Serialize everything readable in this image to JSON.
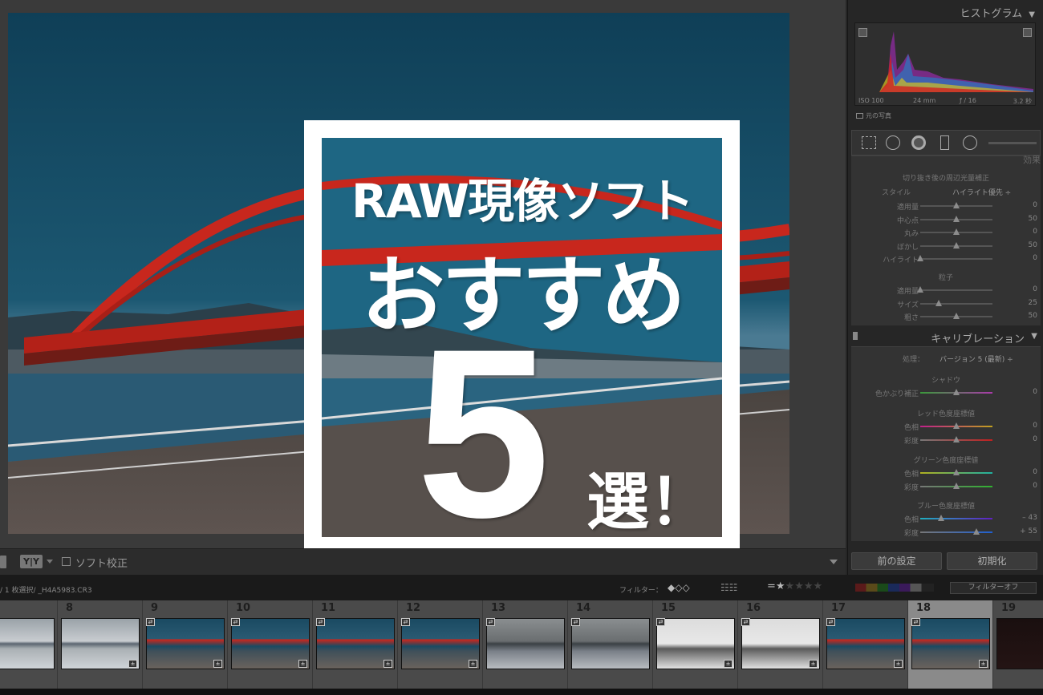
{
  "overlay": {
    "line1": "RAW現像ソフト",
    "line2": "おすすめ",
    "number": "5",
    "suffix": "選！"
  },
  "histogram": {
    "title": "ヒストグラム",
    "iso": "ISO 100",
    "focal": "24 mm",
    "aperture": "ƒ / 16",
    "shutter": "3.2 秒",
    "original_label": "元の写真"
  },
  "effects": {
    "title": "効果",
    "vignette_title": "切り抜き後の周辺光量補正",
    "style_label": "スタイル",
    "style_value": "ハイライト優先 ÷",
    "vignette_rows": [
      {
        "label": "適用量",
        "value": "0",
        "pos": 0.5
      },
      {
        "label": "中心点",
        "value": "50",
        "pos": 0.5
      },
      {
        "label": "丸み",
        "value": "0",
        "pos": 0.5
      },
      {
        "label": "ぼかし",
        "value": "50",
        "pos": 0.5
      },
      {
        "label": "ハイライト",
        "value": "0",
        "pos": 0.0
      }
    ],
    "grain_title": "粒子",
    "grain_rows": [
      {
        "label": "適用量",
        "value": "0",
        "pos": 0.0
      },
      {
        "label": "サイズ",
        "value": "25",
        "pos": 0.25
      },
      {
        "label": "粗さ",
        "value": "50",
        "pos": 0.5
      }
    ]
  },
  "calibration": {
    "title": "キャリブレーション",
    "process_label": "処理：",
    "process_value": "バージョン 5 (最新) ÷",
    "shadow_title": "シャドウ",
    "shadow_row": {
      "label": "色かぶり補正",
      "value": "0",
      "pos": 0.5
    },
    "red_title": "レッド色度座標値",
    "red_rows": [
      {
        "label": "色相",
        "value": "0",
        "pos": 0.5
      },
      {
        "label": "彩度",
        "value": "0",
        "pos": 0.5
      }
    ],
    "green_title": "グリーン色度座標値",
    "green_rows": [
      {
        "label": "色相",
        "value": "0",
        "pos": 0.5
      },
      {
        "label": "彩度",
        "value": "0",
        "pos": 0.5
      }
    ],
    "blue_title": "ブルー色度座標値",
    "blue_rows": [
      {
        "label": "色相",
        "value": "– 43",
        "pos": 0.29
      },
      {
        "label": "彩度",
        "value": "+ 55",
        "pos": 0.78
      }
    ]
  },
  "buttons": {
    "previous": "前の設定",
    "reset": "初期化"
  },
  "toolbar": {
    "view_mode": "Y|Y",
    "soft_proof": "ソフト校正"
  },
  "filmstrip": {
    "path": "/ 1 枚選択/ _H4A5983.CR3",
    "filter_label": "フィルター：",
    "filter_off": "フィルターオフ",
    "cells": [
      {
        "num": "",
        "style": "bright"
      },
      {
        "num": "8",
        "style": "bright"
      },
      {
        "num": "9",
        "style": "bridge"
      },
      {
        "num": "10",
        "style": "bridge"
      },
      {
        "num": "11",
        "style": "bridge"
      },
      {
        "num": "12",
        "style": "bridge"
      },
      {
        "num": "13",
        "style": "grey"
      },
      {
        "num": "14",
        "style": "grey"
      },
      {
        "num": "15",
        "style": "white"
      },
      {
        "num": "16",
        "style": "white"
      },
      {
        "num": "17",
        "style": "bridge"
      },
      {
        "num": "18",
        "style": "bridge"
      },
      {
        "num": "19",
        "style": "dark"
      }
    ],
    "selected_index": 11
  },
  "colors": {
    "sky": "#1c5670",
    "bridge": "#c8271d",
    "panel_bg": "#262626"
  }
}
